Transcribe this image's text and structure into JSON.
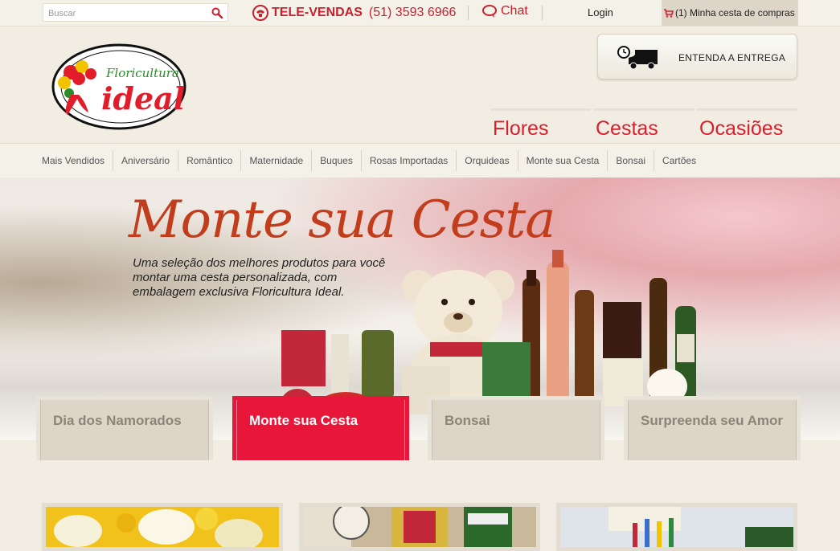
{
  "topbar": {
    "search_placeholder": "Buscar",
    "phone_label": "TELE-VENDAS",
    "phone_number": "(51) 3593 6966",
    "chat_label": "Chat",
    "login_label": "Login",
    "cart_label": "(1) Minha cesta de compras"
  },
  "header": {
    "logo_text": "Floricultura ideal",
    "delivery_label": "ENTENDA A ENTREGA",
    "main_tabs": [
      {
        "label": "Flores"
      },
      {
        "label": "Cestas"
      },
      {
        "label": "Ocasiões"
      }
    ]
  },
  "subnav": {
    "items": [
      {
        "label": "Mais Vendidos"
      },
      {
        "label": "Aniversário"
      },
      {
        "label": "Romântico"
      },
      {
        "label": "Maternidade"
      },
      {
        "label": "Buques"
      },
      {
        "label": "Rosas Importadas"
      },
      {
        "label": "Orquideas"
      },
      {
        "label": "Monte sua Cesta"
      },
      {
        "label": "Bonsai"
      },
      {
        "label": "Cartões"
      }
    ]
  },
  "hero": {
    "title": "Monte sua Cesta",
    "subtitle": "Uma seleção dos melhores produtos para você montar uma cesta personalizada, com embalagem exclusiva Floricultura Ideal."
  },
  "promo_tabs": [
    {
      "label": "Dia dos Namorados",
      "active": false
    },
    {
      "label": "Monte sua Cesta",
      "active": true
    },
    {
      "label": "Bonsai",
      "active": false
    },
    {
      "label": "Surpreenda seu Amor",
      "active": false
    }
  ],
  "colors": {
    "brand_red": "#d81f2e",
    "active_tab": "#e8173a",
    "background": "#f1ede3"
  }
}
